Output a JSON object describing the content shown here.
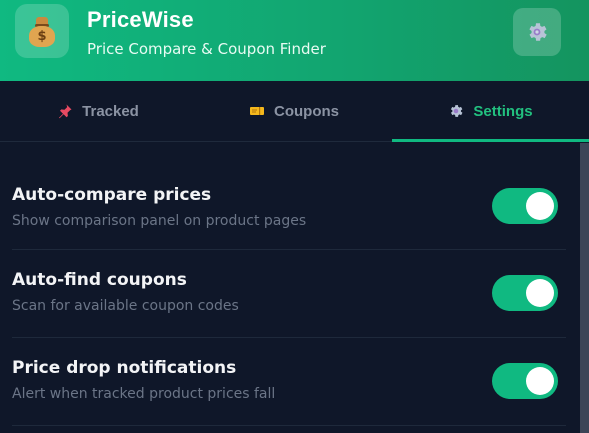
{
  "header": {
    "logo_icon": "money-bag-icon",
    "title": "PriceWise",
    "subtitle": "Price Compare & Coupon Finder",
    "settings_icon": "gear-icon"
  },
  "tabs": [
    {
      "label": "Tracked",
      "icon": "pushpin-icon",
      "active": false
    },
    {
      "label": "Coupons",
      "icon": "ticket-icon",
      "active": false
    },
    {
      "label": "Settings",
      "icon": "gear-icon",
      "active": true
    }
  ],
  "settings": [
    {
      "title": "Auto-compare prices",
      "description": "Show comparison panel on product pages",
      "enabled": true
    },
    {
      "title": "Auto-find coupons",
      "description": "Scan for available coupon codes",
      "enabled": true
    },
    {
      "title": "Price drop notifications",
      "description": "Alert when tracked product prices fall",
      "enabled": true
    }
  ],
  "colors": {
    "accent": "#10b981",
    "background": "#0f1729",
    "muted_text": "#6b7587"
  }
}
